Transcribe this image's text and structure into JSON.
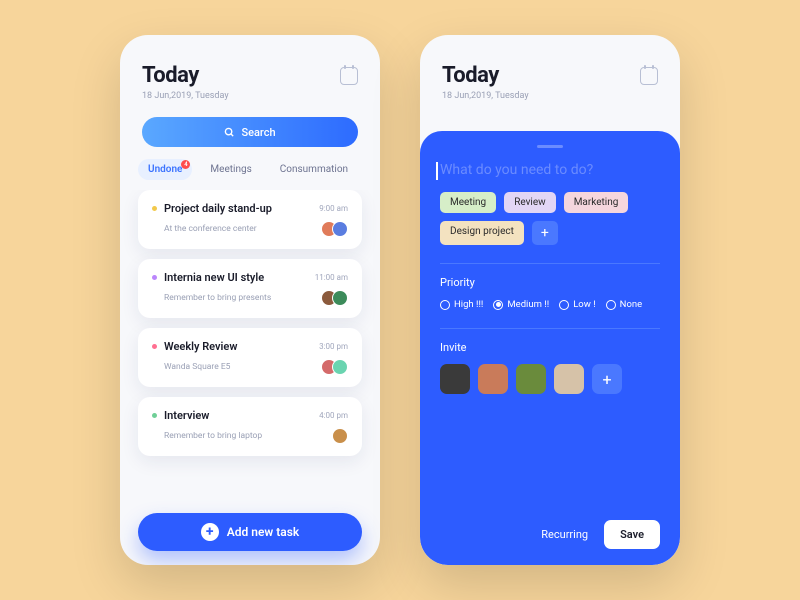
{
  "header": {
    "title": "Today",
    "date": "18 Jun,2019, Tuesday"
  },
  "search": {
    "label": "Search"
  },
  "tabs": {
    "undone": "Undone",
    "meetings": "Meetings",
    "cons": "Consummation",
    "badge": "4"
  },
  "tasks": [
    {
      "title": "Project daily stand-up",
      "sub": "At the conference center",
      "time": "9:00 am",
      "dot": "#f2c94c",
      "avatars": [
        "#e07b5a",
        "#5a7de0"
      ]
    },
    {
      "title": "Internia new UI style",
      "sub": "Remember to bring presents",
      "time": "11:00 am",
      "dot": "#bb86fc",
      "avatars": [
        "#8b5a3c",
        "#3c8b5a"
      ]
    },
    {
      "title": "Weekly Review",
      "sub": "Wanda Square E5",
      "time": "3:00 pm",
      "dot": "#ff6f91",
      "avatars": [
        "#d46a6a",
        "#6ad4b0"
      ]
    },
    {
      "title": "Interview",
      "sub": "Remember to bring laptop",
      "time": "4:00 pm",
      "dot": "#6fcf97",
      "avatars": [
        "#c98f4a"
      ]
    }
  ],
  "addTask": "Add new task",
  "sheet": {
    "prompt": "What do you need to do?",
    "tags": [
      {
        "label": "Meeting",
        "bg": "#d6eec8"
      },
      {
        "label": "Review",
        "bg": "#e2d6f5"
      },
      {
        "label": "Marketing",
        "bg": "#f5d6dd"
      },
      {
        "label": "Design project",
        "bg": "#f3e2c0"
      }
    ],
    "priorityTitle": "Priority",
    "priority": {
      "high": "High !!!",
      "medium": "Medium !!",
      "low": "Low !",
      "none": "None"
    },
    "inviteTitle": "Invite",
    "invitees": [
      "#3a3a3a",
      "#c97b5a",
      "#6a8b3c",
      "#d6c2a8"
    ],
    "recurring": "Recurring",
    "save": "Save"
  }
}
